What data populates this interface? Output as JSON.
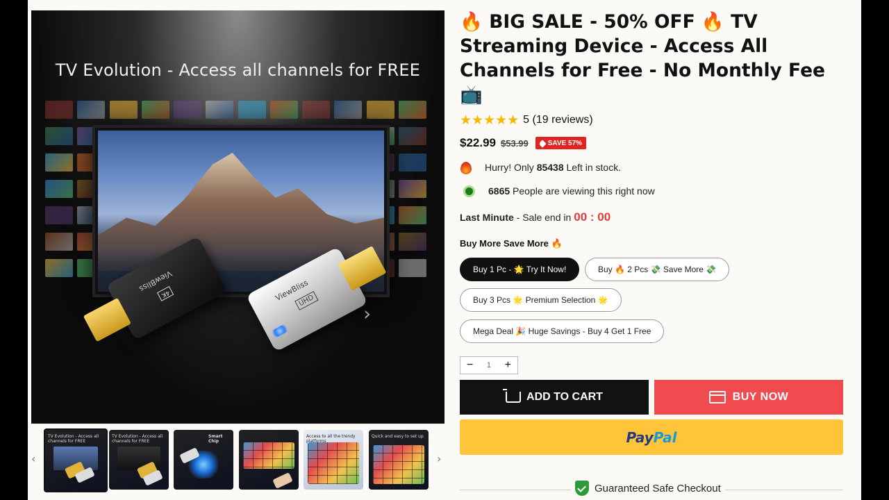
{
  "gallery": {
    "headline": "TV Evolution - Access all channels for FREE",
    "brand_print": "ViewBliss",
    "badge_4k": "4K",
    "badge_uhd": "UHD",
    "nav_prev": "‹",
    "nav_next": "›",
    "image_prev": "‹",
    "image_next": "›",
    "thumbnails": [
      {
        "caption": "TV Evolution - Access all channels for FREE"
      },
      {
        "caption": "TV Evolution - Access all channels for FREE"
      },
      {
        "caption": "Smart Chip"
      },
      {
        "caption": ""
      },
      {
        "caption": "Access to all the trendy platforms"
      },
      {
        "caption": "Quick and easy to set up"
      }
    ]
  },
  "product": {
    "title": "🔥 BIG SALE - 50% OFF 🔥 TV Streaming Device - Access All Channels for Free - No Monthly Fee 📺",
    "stars": "★★★★★",
    "rating_text": "5 (19 reviews)",
    "price": "$22.99",
    "compare_price": "$53.99",
    "save_badge": "SAVE 57%",
    "stock_prefix": "Hurry! Only ",
    "stock_count": "85438",
    "stock_suffix": " Left in stock.",
    "viewers_count": "6865",
    "viewers_text": " People are viewing this right now",
    "countdown_label": "Last Minute",
    "countdown_text": " - Sale end in ",
    "countdown_timer": "00 : 00",
    "bundle_title": "Buy More Save More 🔥",
    "options": [
      "Buy 1 Pc - 🌟 Try It Now!",
      "Buy 🔥 2 Pcs 💸 Save More 💸",
      "Buy 3 Pcs 🌟 Premium Selection 🌟",
      "Mega Deal 🎉 Huge Savings - Buy 4 Get 1 Free"
    ],
    "selected_option": 0,
    "quantity": "1",
    "qty_minus": "−",
    "qty_plus": "+",
    "add_to_cart": "ADD TO CART",
    "buy_now": "BUY NOW",
    "paypal_1": "Pay",
    "paypal_2": "Pal",
    "safe_checkout": "Guaranteed Safe Checkout"
  },
  "colors": {
    "accent_red": "#f04b4f",
    "badge_red": "#e02424",
    "paypal_yellow": "#ffc439",
    "star_gold": "#f5b800",
    "timer_red": "#e23b3b"
  }
}
